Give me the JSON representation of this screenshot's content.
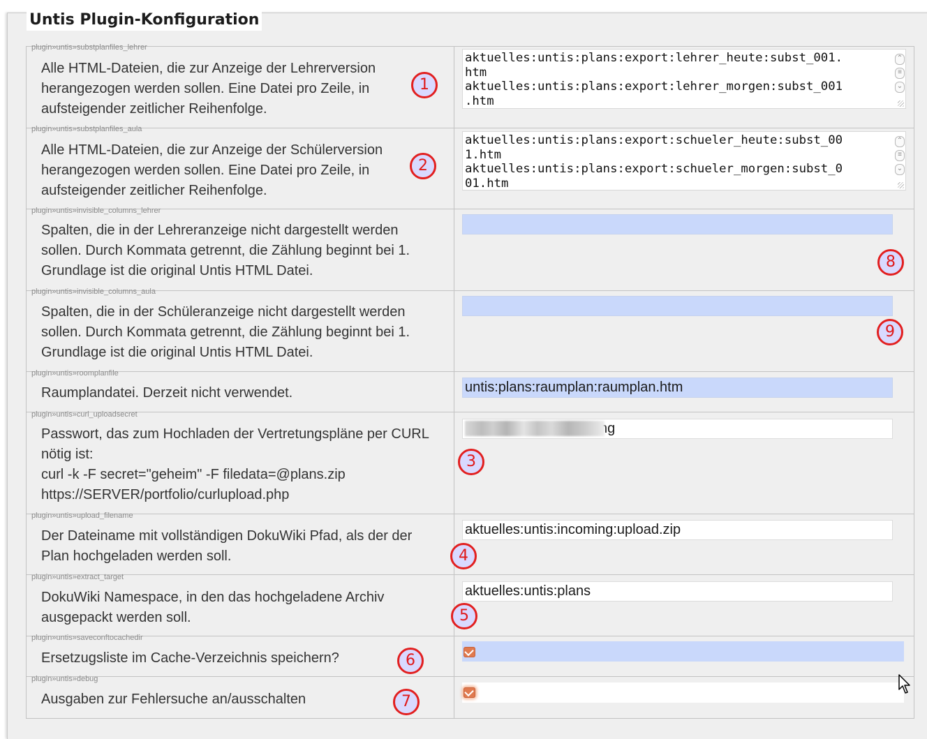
{
  "panel": {
    "title": "Untis Plugin-Konfiguration"
  },
  "rows": [
    {
      "key": "plugin»untis»substplanfiles_lehrer",
      "lines": [
        "Alle HTML-Dateien, die zur Anzeige der Lehrerversion",
        "herangezogen werden sollen. Eine Datei pro Zeile, in",
        "aufsteigender zeitlicher Reihenfolge."
      ],
      "value_lines": [
        "aktuelles:untis:plans:export:lehrer_heute:subst_001.",
        "htm",
        "aktuelles:untis:plans:export:lehrer_morgen:subst_001",
        ".htm"
      ],
      "marker": "1"
    },
    {
      "key": "plugin»untis»substplanfiles_aula",
      "lines": [
        "Alle HTML-Dateien, die zur Anzeige der Schülerversion",
        "herangezogen werden sollen. Eine Datei pro Zeile, in",
        "aufsteigender zeitlicher Reihenfolge."
      ],
      "value_lines": [
        "aktuelles:untis:plans:export:schueler_heute:subst_00",
        "1.htm",
        "aktuelles:untis:plans:export:schueler_morgen:subst_0",
        "01.htm"
      ],
      "marker": "2"
    },
    {
      "key": "plugin»untis»invisible_columns_lehrer",
      "lines": [
        "Spalten, die in der Lehreranzeige nicht dargestellt werden",
        "sollen. Durch Kommata getrennt, die Zählung beginnt bei 1.",
        "Grundlage ist die original Untis HTML Datei."
      ],
      "value": "",
      "marker": "8"
    },
    {
      "key": "plugin»untis»invisible_columns_aula",
      "lines": [
        "Spalten, die in der Schüleranzeige nicht dargestellt werden",
        "sollen. Durch Kommata getrennt, die Zählung beginnt bei 1.",
        "Grundlage ist die original Untis HTML Datei."
      ],
      "value": "",
      "marker": "9"
    },
    {
      "key": "plugin»untis»roomplanfile",
      "lines": [
        "Raumplandatei. Derzeit nicht verwendet."
      ],
      "value": "untis:plans:raumplan:raumplan.htm"
    },
    {
      "key": "plugin»untis»curl_uploadsecret",
      "lines": [
        "Passwort, das zum Hochladen der Vertretungspläne per CURL",
        "nötig ist:",
        "curl -k -F secret=\"geheim\" -F filedata=@plans.zip",
        "https://SERVER/portfolio/curlupload.php"
      ],
      "value": "ng",
      "marker": "3"
    },
    {
      "key": "plugin»untis»upload_filename",
      "lines": [
        "Der Dateiname mit vollständigen DokuWiki Pfad, als der der",
        "Plan hochgeladen werden soll."
      ],
      "value": "aktuelles:untis:incoming:upload.zip",
      "marker": "4"
    },
    {
      "key": "plugin»untis»extract_target",
      "lines": [
        "DokuWiki Namespace, in den das hochgeladene Archiv",
        "ausgepackt werden soll."
      ],
      "value": "aktuelles:untis:plans",
      "marker": "5"
    },
    {
      "key": "plugin»untis»saveconftocachedir",
      "lines": [
        "Ersetzugsliste im Cache-Verzeichnis speichern?"
      ],
      "checked": true,
      "marker": "6"
    },
    {
      "key": "plugin»untis»debug",
      "lines": [
        "Ausgaben zur Fehlersuche an/ausschalten"
      ],
      "checked": true,
      "marker": "7"
    }
  ],
  "colors": {
    "highlight": "#c9d8fb",
    "marker": "#e21f1f",
    "checkbox": "#e07a4f"
  }
}
